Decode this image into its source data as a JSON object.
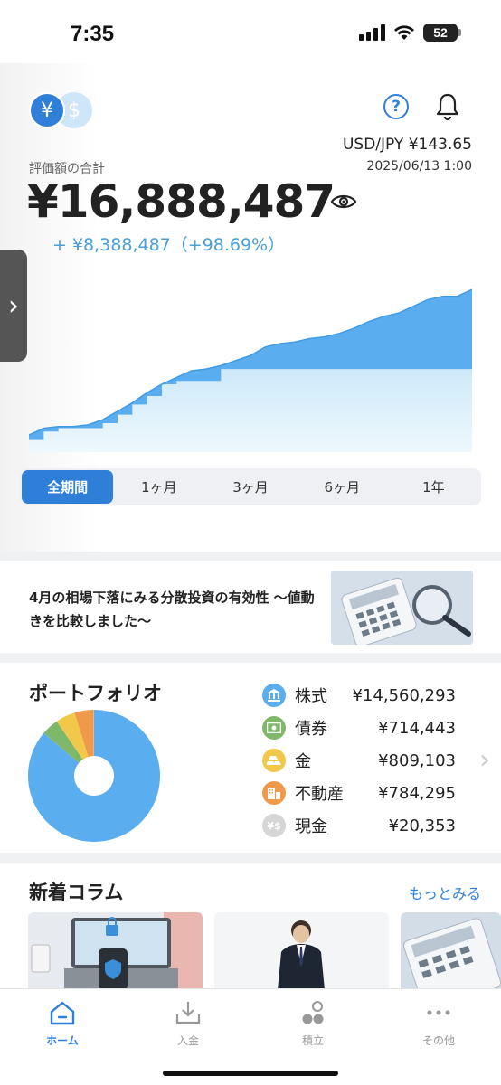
{
  "status_bar": {
    "time": "7:35",
    "battery": "52"
  },
  "header": {
    "currency_yen": "¥",
    "currency_usd": "$",
    "fx_rate": "USD/JPY ¥143.65",
    "fx_timestamp": "2025/06/13 1:00",
    "total_label": "評価額の合計",
    "total_value": "¥16,888,487",
    "total_change": "+ ¥8,388,487（+98.69%）"
  },
  "chart_data": {
    "type": "area",
    "series": [
      {
        "values": [
          0.08,
          0.12,
          0.13,
          0.13,
          0.14,
          0.17,
          0.22,
          0.27,
          0.33,
          0.38,
          0.42,
          0.46,
          0.47,
          0.49,
          0.52,
          0.55,
          0.6,
          0.62,
          0.63,
          0.65,
          0.66,
          0.68,
          0.71,
          0.75,
          0.78,
          0.8,
          0.84,
          0.88,
          0.9,
          0.9,
          0.94
        ]
      },
      {
        "values": [
          0.05,
          0.1,
          0.12,
          0.12,
          0.12,
          0.15,
          0.2,
          0.26,
          0.31,
          0.38,
          0.4,
          0.4,
          0.4,
          0.47,
          0.47,
          0.47,
          0.47,
          0.47,
          0.47,
          0.47,
          0.47,
          0.47,
          0.47,
          0.47,
          0.47,
          0.47,
          0.47,
          0.47,
          0.47,
          0.47,
          0.47
        ]
      }
    ],
    "colors": {
      "total": "#5aaef0",
      "principal": "#d7effb"
    }
  },
  "period_tabs": [
    {
      "label": "全期間",
      "active": true
    },
    {
      "label": "1ヶ月",
      "active": false
    },
    {
      "label": "3ヶ月",
      "active": false
    },
    {
      "label": "6ヶ月",
      "active": false
    },
    {
      "label": "1年",
      "active": false
    }
  ],
  "article": {
    "title": "4月の相場下落にみる分散投資の有効性 〜値動きを比較しました〜"
  },
  "portfolio": {
    "title": "ポートフォリオ",
    "items": [
      {
        "name": "株式",
        "value": "¥14,560,293",
        "amount": 14560293,
        "color": "#5aaef0",
        "icon": "bank-icon"
      },
      {
        "name": "債券",
        "value": "¥714,443",
        "amount": 714443,
        "color": "#7fb86a",
        "icon": "bond-icon"
      },
      {
        "name": "金",
        "value": "¥809,103",
        "amount": 809103,
        "color": "#f2c84b",
        "icon": "gold-icon"
      },
      {
        "name": "不動産",
        "value": "¥784,295",
        "amount": 784295,
        "color": "#ef9a4a",
        "icon": "building-icon"
      },
      {
        "name": "現金",
        "value": "¥20,353",
        "amount": 20353,
        "color": "#d6d6d6",
        "icon": "cash-icon"
      }
    ]
  },
  "columns": {
    "title": "新着コラム",
    "more": "もっとみる"
  },
  "tab_bar": [
    {
      "label": "ホーム",
      "icon": "home-icon",
      "active": true
    },
    {
      "label": "入金",
      "icon": "deposit-icon",
      "active": false
    },
    {
      "label": "積立",
      "icon": "accumulate-icon",
      "active": false
    },
    {
      "label": "その他",
      "icon": "more-icon",
      "active": false
    }
  ]
}
